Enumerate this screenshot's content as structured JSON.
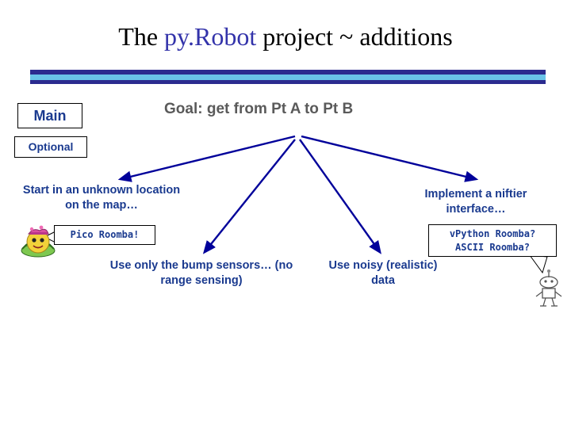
{
  "slide": {
    "title": {
      "before": "The ",
      "accent": "py.Robot",
      "after": " project ~ additions"
    },
    "labels": {
      "main": "Main",
      "optional": "Optional"
    },
    "goal": "Goal: get from Pt A to Pt B",
    "leaves": {
      "start": "Start in an unknown location on the map…",
      "bump": "Use only the bump sensors… (no range sensing)",
      "noisy": "Use noisy (realistic) data",
      "interface": "Implement a niftier interface…"
    },
    "bubbles": {
      "pico": "Pico Roomba!",
      "vpython_line1": "vPython Roomba?",
      "vpython_line2": "ASCII Roomba?"
    },
    "colors": {
      "title_accent": "#3333aa",
      "text_blue": "#1a3a8f",
      "goal_gray": "#5a5a5a",
      "bar_dark": "#2b2b8f",
      "bar_light": "#69c3e8",
      "arrow": "#00009a"
    },
    "icons": {
      "roomba": "roomba-sprite-icon",
      "robot": "robot-sprite-icon"
    }
  }
}
